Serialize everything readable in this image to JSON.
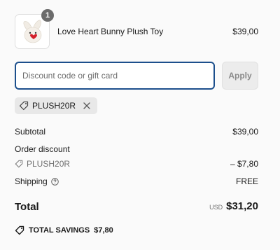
{
  "cart": {
    "item": {
      "name": "Love Heart Bunny Plush Toy",
      "quantity": "1",
      "price": "$39,00",
      "image_icon": "bunny-plush-thumbnail"
    }
  },
  "discount": {
    "placeholder": "Discount code or gift card",
    "value": "",
    "apply_label": "Apply",
    "applied_code": "PLUSH20R"
  },
  "summary": {
    "subtotal_label": "Subtotal",
    "subtotal_value": "$39,00",
    "order_discount_label": "Order discount",
    "discount_code": "PLUSH20R",
    "discount_value": "– $7,80",
    "shipping_label": "Shipping",
    "shipping_value": "FREE",
    "total_label": "Total",
    "currency": "USD",
    "total_value": "$31,20",
    "savings_label": "TOTAL SAVINGS",
    "savings_value": "$7,80"
  },
  "colors": {
    "focus_border": "#1c4f8c",
    "chip_bg": "#e8e8e8",
    "badge_bg": "#6b6b6b"
  }
}
